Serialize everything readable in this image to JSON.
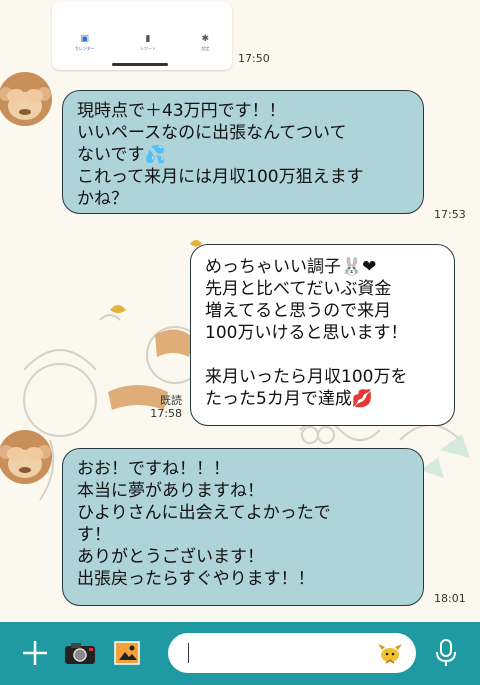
{
  "image_message": {
    "tabs": [
      {
        "label": "カレンダー"
      },
      {
        "label": "レポート"
      },
      {
        "label": "設定"
      }
    ],
    "time": "17:50"
  },
  "messages": [
    {
      "sender": "other",
      "text": "現時点で＋43万円です！！\nいいペースなのに出張なんてついて\nないです💦\nこれって来月には月収100万狙えます\nかね？",
      "time": "17:53"
    },
    {
      "sender": "self",
      "text": "めっちゃいい調子🐰❤\n先月と比べてだいぶ資金\n増えてると思うので来月\n100万いけると思います！\n\n来月いったら月収100万を\nたった5カ月で達成💋",
      "read": "既読",
      "time": "17:58"
    },
    {
      "sender": "other",
      "text": "おお！ですね！！！\n本当に夢がありますね！\nひよりさんに出会えてよかったで\nす！\nありがとうございます！\n出張戻ったらすぐやります！！",
      "time": "18:01"
    }
  ],
  "input": {
    "value": "",
    "placeholder": ""
  },
  "icons": {
    "add": "plus-icon",
    "camera": "camera-icon",
    "gallery": "image-icon",
    "sticker": "sticker-icon",
    "mic": "mic-icon"
  },
  "colors": {
    "incoming_bubble": "#aed3d9",
    "outgoing_bubble": "#ffffff",
    "input_bar": "#1f9aa3",
    "background": "#fbf8ef"
  }
}
